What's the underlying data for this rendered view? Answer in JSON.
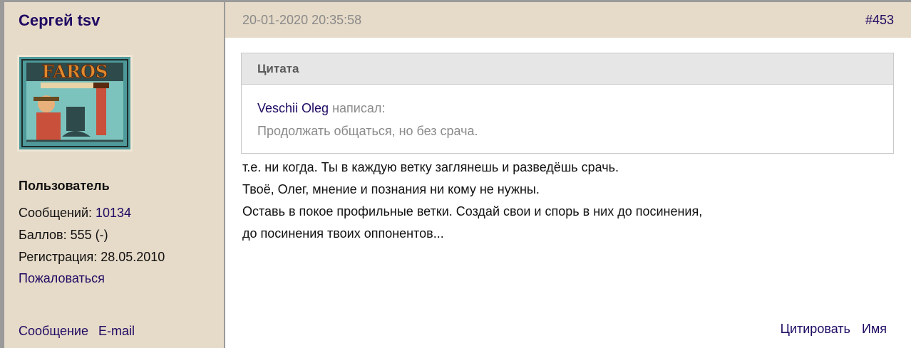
{
  "author": {
    "name": "Сергей tsv",
    "role": "Пользователь",
    "messages_label": "Сообщений:",
    "messages_count": "10134",
    "points": "Баллов: 555 (-)",
    "registration": "Регистрация: 28.05.2010",
    "complain_label": "Пожаловаться",
    "message_link": "Сообщение",
    "email_link": "E-mail",
    "avatar_text": "FAROS"
  },
  "post": {
    "date": "20-01-2020 20:35:58",
    "number": "#453",
    "quote": {
      "title": "Цитата",
      "author": "Veschii Oleg",
      "wrote": "написал:",
      "text": "Продолжать общаться, но без срача."
    },
    "lines": [
      "т.е. ни когда. Ты в каждую ветку заглянешь и разведёшь срачь.",
      "Твоё, Олег, мнение и познания ни кому не нужны.",
      "Оставь в покое профильные ветки. Создай свои и спорь в них до посинения,",
      "до посинения твоих оппонентов..."
    ],
    "actions": {
      "quote": "Цитировать",
      "name": "Имя"
    }
  },
  "colors": {
    "sidebar_bg": "#e6dac8",
    "link": "#1f0a63",
    "muted": "#8a8a8a"
  }
}
